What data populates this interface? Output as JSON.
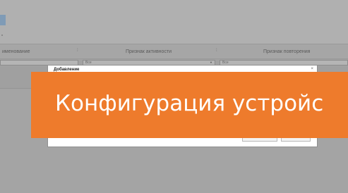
{
  "table": {
    "columns": [
      {
        "label": "именование"
      },
      {
        "label": "Признак активности"
      },
      {
        "label": "Признак повторения"
      }
    ],
    "filters": {
      "activity": {
        "value": "Все"
      },
      "repeat": {
        "value": "Все"
      }
    }
  },
  "dialog": {
    "title": "Добавление",
    "close_glyph": "×"
  },
  "overlay": {
    "text": "Конфигурация устройс",
    "background_color": "#ee7b2c"
  }
}
